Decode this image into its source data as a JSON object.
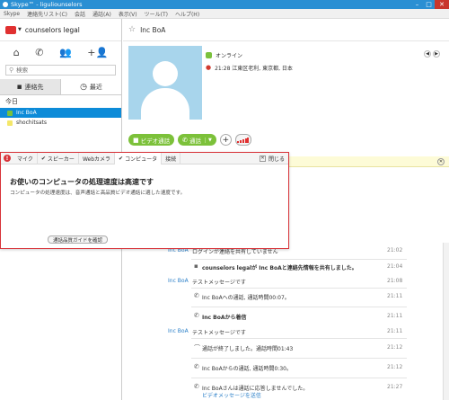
{
  "window": {
    "title": "Skype™ - liguliounselors"
  },
  "menu": [
    "Skype",
    "連絡先リスト(C)",
    "会話",
    "通話(A)",
    "表示(V)",
    "ツール(T)",
    "ヘルプ(H)"
  ],
  "account": {
    "name": "counselors legal"
  },
  "search": {
    "placeholder": "検索"
  },
  "left_tabs": {
    "contacts": "連絡先",
    "recent": "最近"
  },
  "today_label": "今日",
  "contacts": [
    {
      "name": "Inc BoA",
      "selected": true
    },
    {
      "name": "shochitsats",
      "selected": false
    }
  ],
  "contact_header": {
    "name": "Inc BoA"
  },
  "profile": {
    "status": "オンライン",
    "location": "21:28 江東区老利, 東京都, 日本"
  },
  "call_buttons": {
    "video": "ビデオ通話",
    "call": "通話"
  },
  "popup": {
    "tabs": [
      "マイク",
      "スピーカー",
      "Webカメラ",
      "コンピュータ",
      "接続"
    ],
    "close": "閉じる",
    "title": "お使いのコンピュータの処理速度は高速です",
    "body": "コンピュータの処理速度は、音声通話と高品質ビデオ通話に適した速度です。",
    "button": "通話品質ガイドを確認"
  },
  "messages": [
    {
      "sender": "Inc BoA",
      "text": "ログインが連絡を共有していません",
      "time": "21:02"
    },
    {
      "sender": "",
      "text": "counselors legalが Inc BoAと連絡先情報を共有しました。",
      "time": "21:04",
      "icon": "contact"
    },
    {
      "sender": "Inc BoA",
      "text": "テストメッセージです",
      "time": "21:08"
    },
    {
      "sender": "",
      "text": "Inc BoAへの通話, 通話時間00:07。",
      "time": "21:11",
      "icon": "phone"
    },
    {
      "sender": "",
      "text": "Inc BoAから着信",
      "time": "21:11",
      "icon": "phone"
    },
    {
      "sender": "Inc BoA",
      "text": "テストメッセージです",
      "time": "21:11"
    },
    {
      "sender": "",
      "text": "通話が終了しました。通話時間01:43",
      "time": "21:12",
      "icon": "end"
    },
    {
      "sender": "",
      "text": "Inc BoAからの通話, 通話時間0:30。",
      "time": "21:12",
      "icon": "phone"
    },
    {
      "sender": "",
      "text": "Inc BoAさんは通話に応答しませんでした。",
      "time": "21:27",
      "icon": "phone",
      "link": "ビデオメッセージを送信"
    }
  ]
}
